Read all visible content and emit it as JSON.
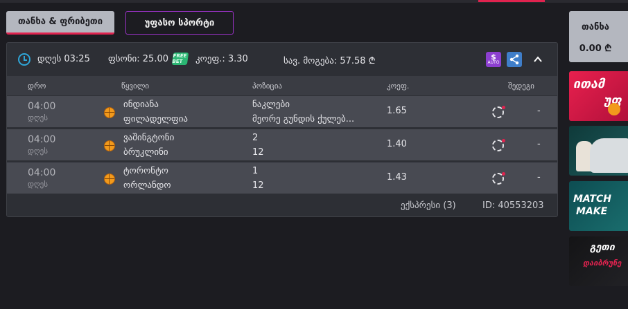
{
  "tabs": [
    {
      "label": "თანხა & ფრიბეთი",
      "active": true
    },
    {
      "label": "უფასო სპორტი",
      "active": false
    }
  ],
  "ticket": {
    "date_label": "დღეს 03:25",
    "bonus_label": "ფსონი: 25.00",
    "freebet_badge": "FREE BET",
    "coef_label": "კოეფ.: 3.30",
    "win_label": "სავ. მოგება: 57.58 ₾",
    "auto_icon_text": "AUTO",
    "auto_icon_symbol": "$"
  },
  "columns": [
    "დრო",
    "წყვილი",
    "პოზიცია",
    "კოეფ.",
    "შედეგი"
  ],
  "rows": [
    {
      "time": "04:00",
      "day": "დღეს",
      "team1": "ინდიანა",
      "team2": "ფილადელფია",
      "pos1": "ნაკლები",
      "pos2": "მეორე გუნდის ქულებ...",
      "odd": "1.65",
      "result": "-"
    },
    {
      "time": "04:00",
      "day": "დღეს",
      "team1": "ვაშინგტონი",
      "team2": "ბრუკლინი",
      "pos1": "2",
      "pos2": "12",
      "odd": "1.40",
      "result": "-"
    },
    {
      "time": "04:00",
      "day": "დღეს",
      "team1": "ტორონტო",
      "team2": "ორლანდო",
      "pos1": "1",
      "pos2": "12",
      "odd": "1.43",
      "result": "-"
    }
  ],
  "footer": {
    "type": "ექსპრესი (3)",
    "id": "ID: 40553203"
  },
  "balance": {
    "label": "თანხა",
    "value": "0.00 ₾"
  },
  "banners": [
    {
      "text1": "ითამ",
      "text2": "უფ"
    },
    {
      "text1": "",
      "text2": ""
    },
    {
      "text1": "MATCH",
      "text2": "MAKE"
    },
    {
      "text1": "გეთი",
      "text2": "დაიბრუნე"
    }
  ],
  "colors": {
    "accent": "#e0234f",
    "clock": "#2fa6d8",
    "freebet": "#2bb673",
    "auto": "#8c3fd0",
    "share": "#3f7ec9"
  }
}
